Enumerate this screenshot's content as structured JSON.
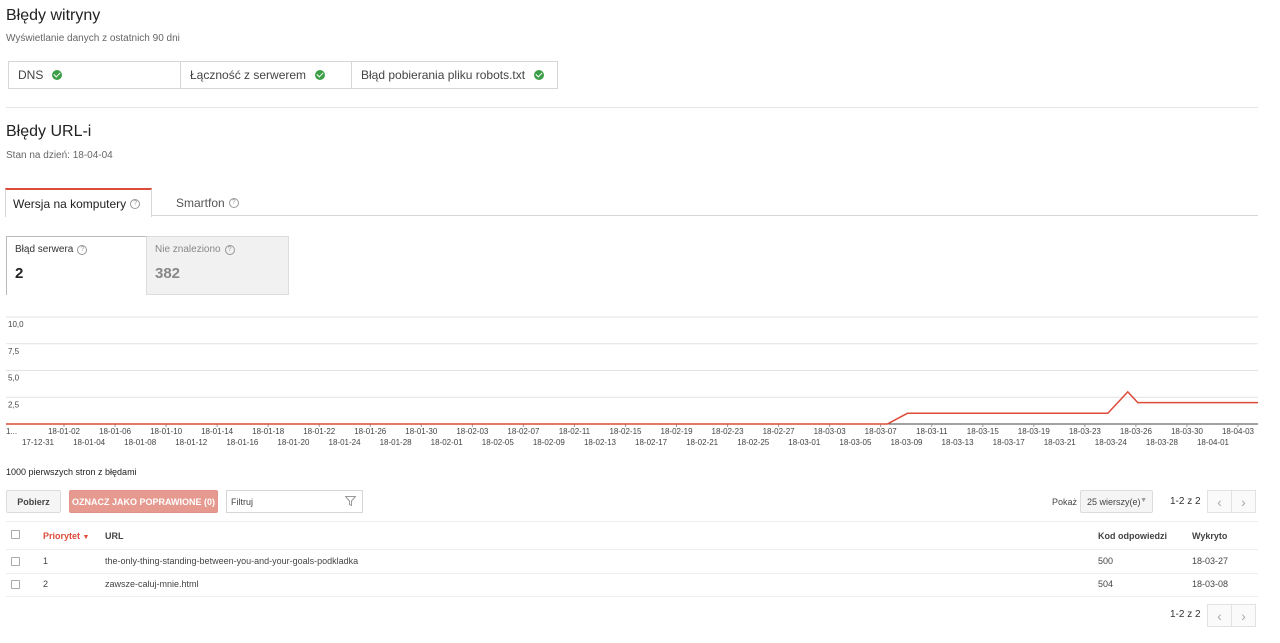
{
  "site_errors": {
    "title": "Błędy witryny",
    "subtitle": "Wyświetlanie danych z ostatnich 90 dni",
    "items": [
      {
        "label": "DNS",
        "status_icon": "check-circle-icon"
      },
      {
        "label": "Łączność z serwerem",
        "status_icon": "check-circle-icon"
      },
      {
        "label": "Błąd pobierania pliku robots.txt",
        "status_icon": "check-circle-icon"
      }
    ],
    "ok_color": "#3c9f48"
  },
  "url_errors": {
    "title": "Błędy URL-i",
    "date_line": "Stan na dzień: 18-04-04"
  },
  "tabs": [
    {
      "label": "Wersja na komputery",
      "active": true
    },
    {
      "label": "Smartfon",
      "active": false
    }
  ],
  "accent_color": "#dd4b39",
  "metrics": [
    {
      "label": "Błąd serwera",
      "value": "2",
      "selected": true
    },
    {
      "label": "Nie znaleziono",
      "value": "382",
      "selected": false
    }
  ],
  "chart_data": {
    "type": "line",
    "ylim": [
      0,
      10
    ],
    "y_ticks": [
      "10,0",
      "7,5",
      "5,0",
      "2,5"
    ],
    "x_label_first": "1...",
    "x_labels_upper": [
      "18-01-02",
      "18-01-06",
      "18-01-10",
      "18-01-14",
      "18-01-18",
      "18-01-22",
      "18-01-26",
      "18-01-30",
      "18-02-03",
      "18-02-07",
      "18-02-11",
      "18-02-15",
      "18-02-19",
      "18-02-23",
      "18-02-27",
      "18-03-03",
      "18-03-07",
      "18-03-11",
      "18-03-15",
      "18-03-19",
      "18-03-23",
      "18-03-26",
      "18-03-30",
      "18-04-03"
    ],
    "x_labels_lower": [
      "17-12-31",
      "18-01-04",
      "18-01-08",
      "18-01-12",
      "18-01-16",
      "18-01-20",
      "18-01-24",
      "18-01-28",
      "18-02-01",
      "18-02-05",
      "18-02-09",
      "18-02-13",
      "18-02-17",
      "18-02-21",
      "18-02-25",
      "18-03-01",
      "18-03-05",
      "18-03-09",
      "18-03-13",
      "18-03-17",
      "18-03-21",
      "18-03-24",
      "18-03-28",
      "18-04-01"
    ],
    "series": [
      {
        "color": "#dd4b39",
        "points": [
          [
            0,
            0
          ],
          [
            88,
            0
          ],
          [
            90,
            1
          ],
          [
            110,
            1
          ],
          [
            112,
            3
          ],
          [
            113,
            2
          ],
          [
            125,
            2
          ]
        ]
      }
    ],
    "x_domain": [
      0,
      125
    ]
  },
  "table": {
    "caption": "1000 pierwszych stron z błędami",
    "download_label": "Pobierz",
    "mark_fixed_label": "OZNACZ JAKO POPRAWIONE (0)",
    "filter_placeholder": "Filtruj",
    "show_label": "Pokaż",
    "rows_per_page": "25 wierszy(e)",
    "page_info": "1-2 z 2",
    "headers": {
      "priority": "Priorytet",
      "url": "URL",
      "code": "Kod odpowiedzi",
      "detected": "Wykryto"
    },
    "rows": [
      {
        "priority": "1",
        "url": "the-only-thing-standing-between-you-and-your-goals-podkladka",
        "code": "500",
        "detected": "18-03-27"
      },
      {
        "priority": "2",
        "url": "zawsze-caluj-mnie.html",
        "code": "504",
        "detected": "18-03-08"
      }
    ]
  }
}
